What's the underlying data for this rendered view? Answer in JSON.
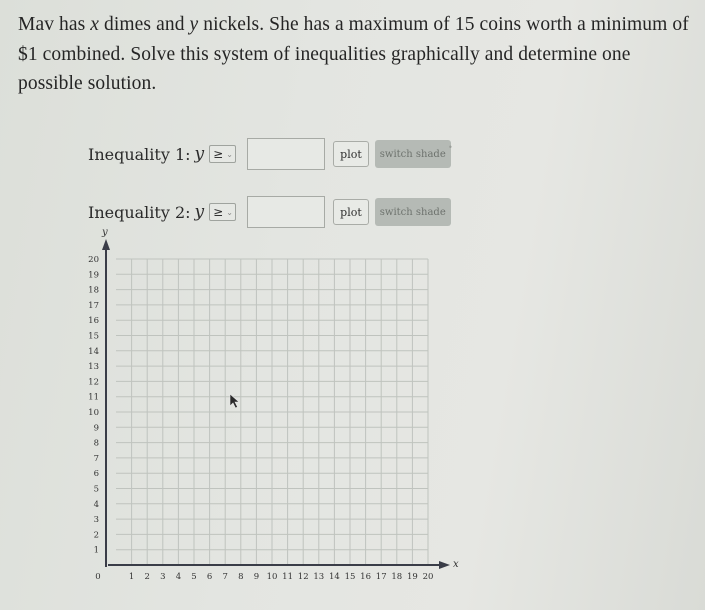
{
  "question": {
    "part1": "Mav has ",
    "var_x": "x",
    "part2": " dimes and ",
    "var_y": "y",
    "part3": " nickels. She has a maximum of 15 coins worth a minimum of $1 combined. Solve this system of inequalities graphically and determine one possible solution."
  },
  "inequalities": [
    {
      "label": "Inequality 1:",
      "variable": "y",
      "operator": "≥",
      "expression_value": "",
      "plot_label": "plot",
      "switch_shade_label": "switch shade"
    },
    {
      "label": "Inequality 2:",
      "variable": "y",
      "operator": "≥",
      "expression_value": "",
      "plot_label": "plot",
      "switch_shade_label": "switch shade"
    }
  ],
  "icons": {
    "dropdown": "chevron-down-icon",
    "cursor": "mouse-pointer-icon"
  },
  "colors": {
    "grid_line": "#bfc3be",
    "axis": "#3a3d48",
    "shade_button_bg": "#b5bab5"
  },
  "chart_data": {
    "type": "line",
    "title": "",
    "xlabel": "x",
    "ylabel": "y",
    "xlim": [
      0,
      20
    ],
    "ylim": [
      0,
      20
    ],
    "grid": true,
    "x_ticks": [
      "0",
      "1",
      "2",
      "3",
      "4",
      "5",
      "6",
      "7",
      "8",
      "9",
      "10",
      "11",
      "12",
      "13",
      "14",
      "15",
      "16",
      "17",
      "18",
      "19",
      "20"
    ],
    "y_ticks": [
      "1",
      "2",
      "3",
      "4",
      "5",
      "6",
      "7",
      "8",
      "9",
      "10",
      "11",
      "12",
      "13",
      "14",
      "15",
      "16",
      "17",
      "18",
      "19",
      "20"
    ],
    "series": []
  }
}
